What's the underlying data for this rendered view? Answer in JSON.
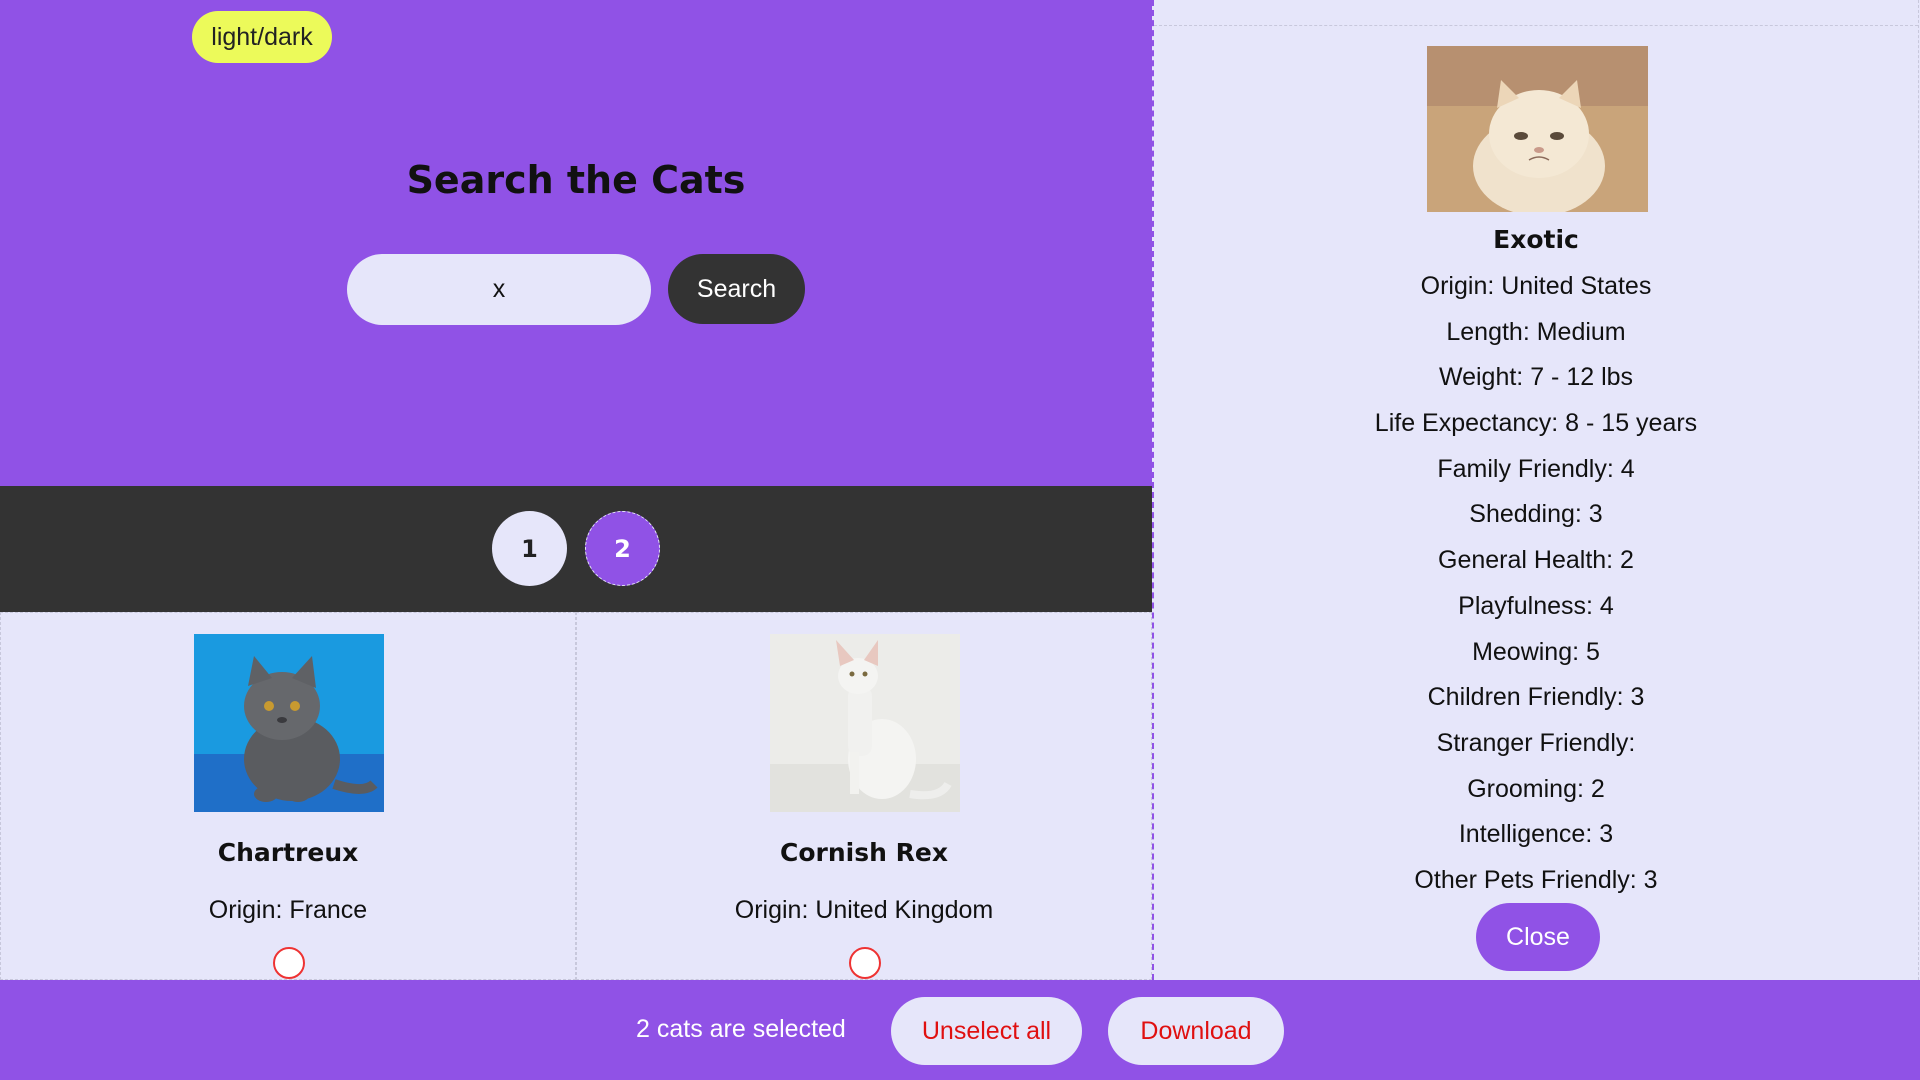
{
  "header": {
    "theme_toggle_label": "light/dark",
    "title": "Search the Cats",
    "search_value": "x",
    "search_button_label": "Search"
  },
  "pagination": {
    "pages": [
      "1",
      "2"
    ],
    "current_page": "2"
  },
  "cards": [
    {
      "name": "Chartreux",
      "origin": "Origin: France",
      "image": "grey-kitten-image"
    },
    {
      "name": "Cornish Rex",
      "origin": "Origin: United Kingdom",
      "image": "white-cat-image"
    }
  ],
  "detail": {
    "name": "Exotic",
    "image": "cream-cat-image",
    "attributes": [
      "Origin: United States",
      "Length: Medium",
      "Weight: 7 - 12 lbs",
      "Life Expectancy: 8 - 15 years",
      "Family Friendly: 4",
      "Shedding: 3",
      "General Health: 2",
      "Playfulness: 4",
      "Meowing: 5",
      "Children Friendly: 3",
      "Stranger Friendly:",
      "Grooming: 2",
      "Intelligence: 3",
      "Other Pets Friendly: 3"
    ],
    "close_label": "Close"
  },
  "footer": {
    "selection_text": "2 cats are selected",
    "unselect_label": "Unselect all",
    "download_label": "Download"
  },
  "colors": {
    "accent": "#9052e6",
    "dark": "#333333",
    "panel": "#e6e6fa",
    "toggle": "#ecfa5a",
    "danger": "#e01010"
  }
}
